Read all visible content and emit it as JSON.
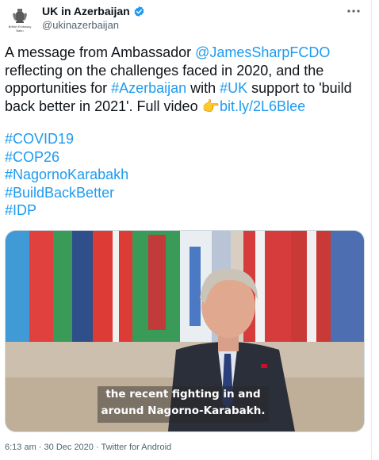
{
  "account": {
    "display_name": "UK in Azerbaijan",
    "handle": "@ukinazerbaijan",
    "avatar_text": "British Embassy Baku",
    "verified_badge_color": "#1d9bf0",
    "avatar_icon": "royal-crest-icon"
  },
  "more_icon": "more-horizontal-icon",
  "tweet": {
    "line1_pre": "A message from Ambassador ",
    "line1_mention": "@JamesSharpFCDO",
    "line2": " reflecting on the challenges faced in 2020, and the",
    "line3_pre": "opportunities for ",
    "line3_tag1": "#Azerbaijan",
    "line3_mid": " with ",
    "line3_tag2": "#UK",
    "line3_post": " support to 'build",
    "line4_pre": "back better in 2021'. Full video ",
    "line4_emoji": "👉",
    "line4_link": "bit.ly/2L6Blee",
    "hashtags": [
      "#COVID19",
      "#COP26",
      "#NagornoKarabakh",
      "#BuildBackBetter",
      "#IDP"
    ]
  },
  "media": {
    "caption_line1": "the recent fighting in and",
    "caption_line2": "around Nagorno-Karabakh."
  },
  "footer": {
    "time": "6:13 am",
    "separator": " · ",
    "date": "30 Dec 2020",
    "separator2": " · ",
    "source": "Twitter for Android"
  },
  "colors": {
    "link": "#1d9bf0",
    "text": "#0f1419",
    "secondary": "#536471"
  }
}
